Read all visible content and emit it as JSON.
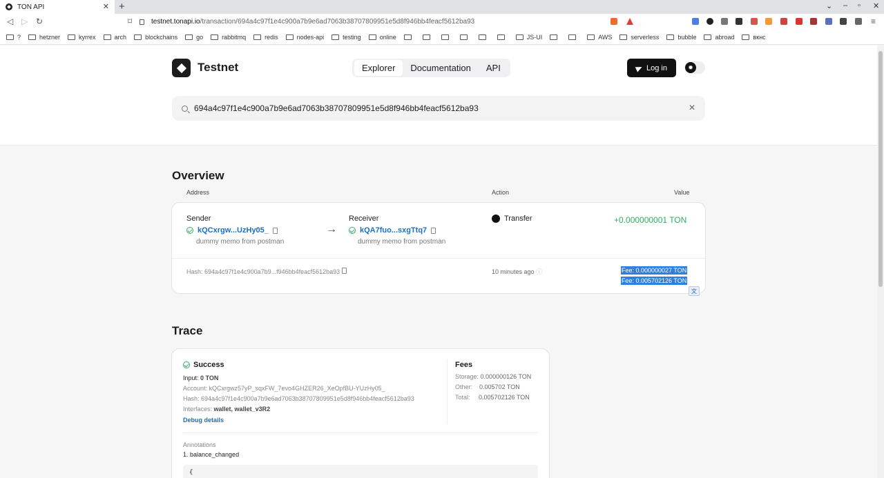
{
  "browser": {
    "tab_title": "TON API",
    "url_host": "testnet.tonapi.io",
    "url_path": "/transaction/694a4c97f1e4c900a7b9e6ad7063b38707809951e5d8f946bb4feacf5612ba93",
    "bookmarks": [
      "?",
      "hetzner",
      "kyrrex",
      "arch",
      "blockchains",
      "go",
      "rabbitmq",
      "redis",
      "nodes-api",
      "testing",
      "online",
      "",
      "",
      "",
      "",
      "",
      "",
      "",
      "",
      "JS-UI",
      "",
      "",
      "AWS",
      "serverless",
      "bubble",
      "abroad",
      "вкнс"
    ]
  },
  "header": {
    "brand": "Testnet",
    "nav": [
      "Explorer",
      "Documentation",
      "API"
    ],
    "login_label": "Log in",
    "search_value": "694a4c97f1e4c900a7b9e6ad7063b38707809951e5d8f946bb4feacf5612ba93"
  },
  "overview": {
    "title": "Overview",
    "columns": {
      "address": "Address",
      "action": "Action",
      "value": "Value"
    },
    "sender_label": "Sender",
    "sender_address": "kQCxrgw...UzHy05_",
    "sender_memo": "dummy memo from postman",
    "receiver_label": "Receiver",
    "receiver_address": "kQA7fuo...sxgTtq7",
    "receiver_memo": "dummy memo from postman",
    "action": "Transfer",
    "value": "+0.000000001 TON",
    "hash": "Hash: 694a4c97f1e4c900a7b9...f946bb4feacf5612ba93",
    "time": "10 minutes ago",
    "fee1": "Fee: 0.000000027 TON",
    "fee2": "Fee: 0.005702126 TON"
  },
  "trace": {
    "title": "Trace",
    "status": "Success",
    "input_label": "Input:",
    "input_value": "0 TON",
    "account": "Account: kQCxrgwz57yP_sqxFW_7evo4GHZER26_XeOpfBU-YUzHy05_",
    "hash": "Hash: 694a4c97f1e4c900a7b9e6ad7063b38707809951e5d8f946bb4feacf5612ba93",
    "interfaces_label": "Interfaces:",
    "interfaces_value": "wallet, wallet_v3R2",
    "debug_link": "Debug details",
    "fees_title": "Fees",
    "fees": [
      {
        "label": "Storage:",
        "value": "0.000000126 TON"
      },
      {
        "label": "Other:",
        "value": "0.005702 TON"
      },
      {
        "label": "Total:",
        "value": "0.005702126 TON"
      }
    ],
    "annotations_title": "Annotations",
    "annotation_1": "1. balance_changed",
    "code_open": "{"
  }
}
